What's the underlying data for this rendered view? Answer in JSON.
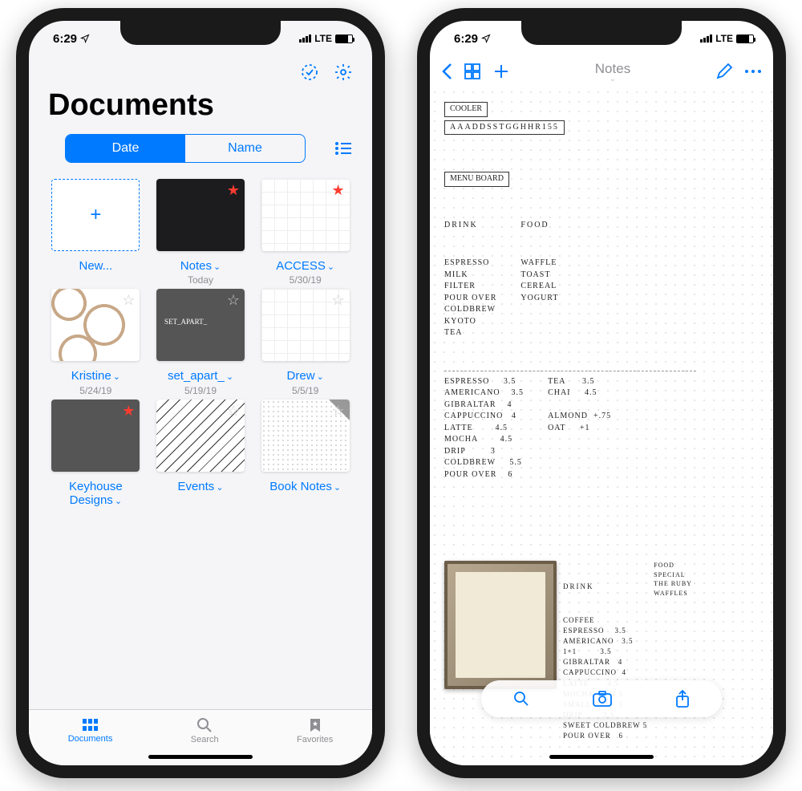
{
  "status": {
    "time": "6:29",
    "carrier": "LTE"
  },
  "left": {
    "title": "Documents",
    "sort": {
      "date": "Date",
      "name": "Name"
    },
    "items": [
      {
        "name": "New...",
        "date": "",
        "kind": "new"
      },
      {
        "name": "Notes",
        "date": "Today",
        "kind": "black",
        "star": true
      },
      {
        "name": "ACCESS",
        "date": "5/30/19",
        "kind": "gridpat",
        "star": true
      },
      {
        "name": "Kristine",
        "date": "5/24/19",
        "kind": "waves"
      },
      {
        "name": "set_apart_",
        "date": "5/19/19",
        "kind": "gray"
      },
      {
        "name": "Drew",
        "date": "5/5/19",
        "kind": "gridpat"
      },
      {
        "name": "Keyhouse Designs",
        "date": "",
        "kind": "gray",
        "star": true
      },
      {
        "name": "Events",
        "date": "",
        "kind": "lines"
      },
      {
        "name": "Book Notes",
        "date": "",
        "kind": "dots",
        "corner": true
      }
    ],
    "tabs": {
      "documents": "Documents",
      "search": "Search",
      "favorites": "Favorites"
    }
  },
  "right": {
    "title": "Notes",
    "note": {
      "heading1": "COOLER",
      "code": "AAADDSSTGGHHR155",
      "heading2": "MENU BOARD",
      "col_drink_hdr": "DRINK",
      "col_food_hdr": "FOOD",
      "drinks1": "ESPRESSO\nMILK\nFILTER\nPOUR OVER\nCOLDBREW\nKYOTO\nTEA",
      "food1": "WAFFLE\nTOAST\nCEREAL\nYOGURT",
      "prices_left": "ESPRESSO     3.5\nAMERICANO    3.5\nGIBRALTAR    4\nCAPPUCCINO   4\nLATTE        4.5\nMOCHA        4.5\nDRIP         3\nCOLDBREW     5.5\nPOUR OVER    6",
      "prices_right": "TEA      3.5\nCHAI     4.5\n\nALMOND  +.75\nOAT     +1",
      "second_hdr": "DRINK",
      "second_list": "COFFEE\nESPRESSO    3.5\nAMERICANO   3.5\n1+1         3.5\nGIBRALTAR   4\nCAPPUCCINO  4\nLATTE       4.5\nMOCHA       4.5\nSMALL DRIP  3\nDRIP        3.5\nSWEET COLDBREW 5\nPOUR OVER   6",
      "second_food": "FOOD\nSPECIAL\nTHE RUBY\nWAFFLES"
    }
  }
}
